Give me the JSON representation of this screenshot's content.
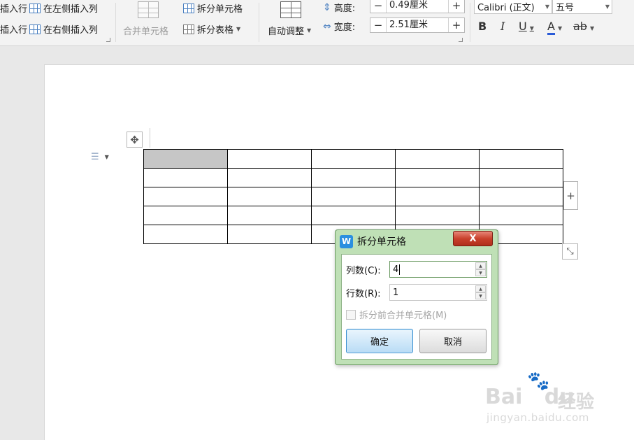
{
  "ribbon": {
    "insert_row_above": "插入行",
    "insert_row_below": "插入行",
    "insert_col_left": "在左侧插入列",
    "insert_col_right": "在右侧插入列",
    "merge_cells": "合并单元格",
    "split_cells": "拆分单元格",
    "split_table": "拆分表格",
    "auto_fit": "自动调整",
    "height_label": "高度:",
    "height_value": "0.49厘米",
    "width_label": "宽度:",
    "width_value": "2.51厘米",
    "font_name": "Calibri (正文)",
    "font_size": "五号",
    "minus": "−",
    "plus": "+",
    "bold": "B",
    "italic": "I",
    "underline": "U",
    "font_color": "A",
    "highlight": "ab"
  },
  "document": {
    "table": {
      "rows": 5,
      "cols": 5,
      "selected_cell": [
        0,
        0
      ]
    }
  },
  "dialog": {
    "title": "拆分单元格",
    "close_label": "X",
    "columns_label": "列数(C):",
    "columns_value": "4",
    "rows_label": "行数(R):",
    "rows_value": "1",
    "merge_before_split_label": "拆分前合并单元格(M)",
    "merge_before_split_checked": false,
    "ok_label": "确定",
    "cancel_label": "取消"
  },
  "watermark": {
    "brand": "Bai",
    "brand2": "du",
    "brand_cn": "经验",
    "url": "jingyan.baidu.com"
  },
  "colors": {
    "dialog_frame": "#bfe0b6",
    "close_button": "#c9412c",
    "primary_button": "#b9dcf5",
    "selected_cell": "#c6c6c6"
  }
}
